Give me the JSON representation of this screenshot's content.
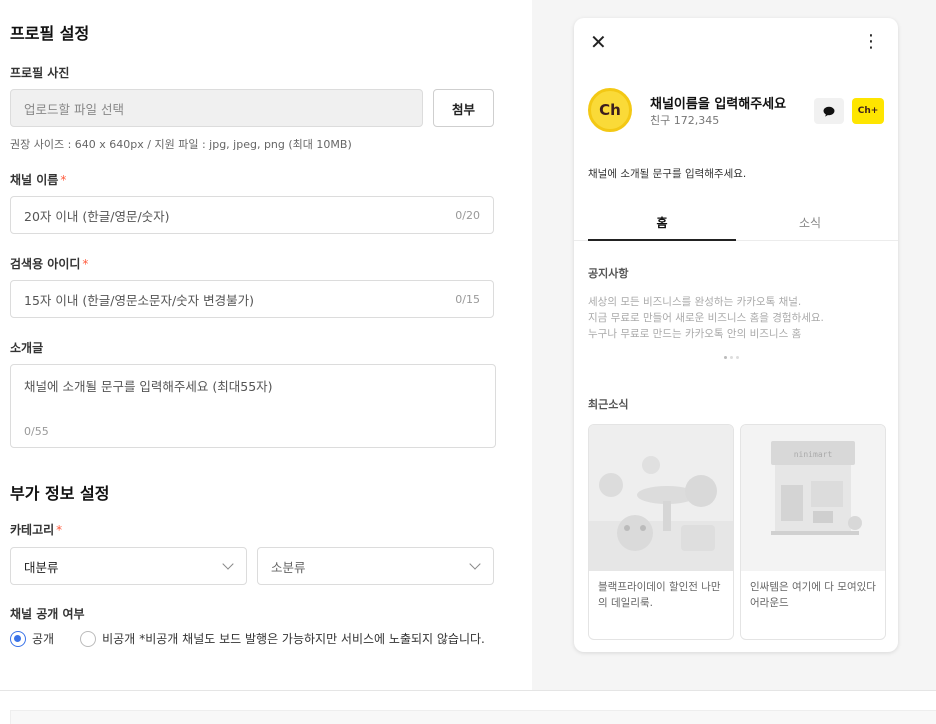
{
  "form": {
    "title": "프로필 설정",
    "photo": {
      "label": "프로필 사진",
      "placeholder": "업로드할 파일 선택",
      "attach_label": "첨부",
      "hint": "권장 사이즈 : 640 x 640px / 지원 파일 : jpg, jpeg, png (최대 10MB)"
    },
    "channel_name": {
      "label": "채널 이름",
      "required": "*",
      "placeholder": "20자 이내 (한글/영문/숫자)",
      "counter": "0/20"
    },
    "search_id": {
      "label": "검색용 아이디",
      "required": "*",
      "placeholder": "15자 이내 (한글/영문소문자/숫자 변경불가)",
      "counter": "0/15"
    },
    "intro": {
      "label": "소개글",
      "placeholder": "채널에 소개될 문구를 입력해주세요 (최대55자)",
      "counter": "0/55"
    },
    "extra_title": "부가 정보 설정",
    "category": {
      "label": "카테고리",
      "required": "*",
      "major": "대분류",
      "minor": "소분류"
    },
    "visibility": {
      "label": "채널 공개 여부",
      "public": "공개",
      "private": "비공개",
      "note": "*비공개 채널도 보드 발행은 가능하지만 서비스에 노출되지 않습니다.",
      "selected": "public"
    }
  },
  "preview": {
    "avatar_text": "Ch",
    "channel_name": "채널이름을 입력해주세요",
    "friends": "친구 172,345",
    "ch_plus_label": "Ch+",
    "intro": "채널에 소개될 문구를 입력해주세요.",
    "tabs": [
      "홈",
      "소식"
    ],
    "notice_title": "공지사항",
    "notice_lines": [
      "세상의 모든 비즈니스를 완성하는 카카오톡 채널.",
      "지금 무료로 만들어 새로운 비즈니스 홈을 경험하세요.",
      "누구나 무료로 만드는 카카오톡 안의 비즈니스 홈"
    ],
    "recent_title": "최근소식",
    "news": [
      {
        "text": "블랙프라이데이 할인전 나만의 데일리룩."
      },
      {
        "text": "인싸템은 여기에 다 모여있다 어라운드",
        "sign": "ninimart"
      }
    ]
  },
  "colors": {
    "accent": "#3a73e8",
    "required": "#ff5a3c",
    "kakao_yellow": "#fee500"
  }
}
